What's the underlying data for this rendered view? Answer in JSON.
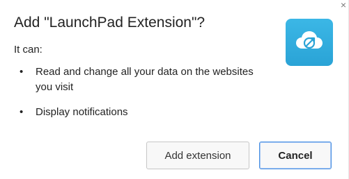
{
  "dialog": {
    "title": "Add \"LaunchPad Extension\"?",
    "subtitle": "It can:",
    "close_icon": "close-icon"
  },
  "permissions": [
    {
      "label": "Read and change all your data on the websites you visit"
    },
    {
      "label": "Display notifications"
    }
  ],
  "app": {
    "icon": "cloud-app-icon",
    "icon_color": "#34b0e3"
  },
  "buttons": {
    "add_label": "Add extension",
    "cancel_label": "Cancel"
  }
}
